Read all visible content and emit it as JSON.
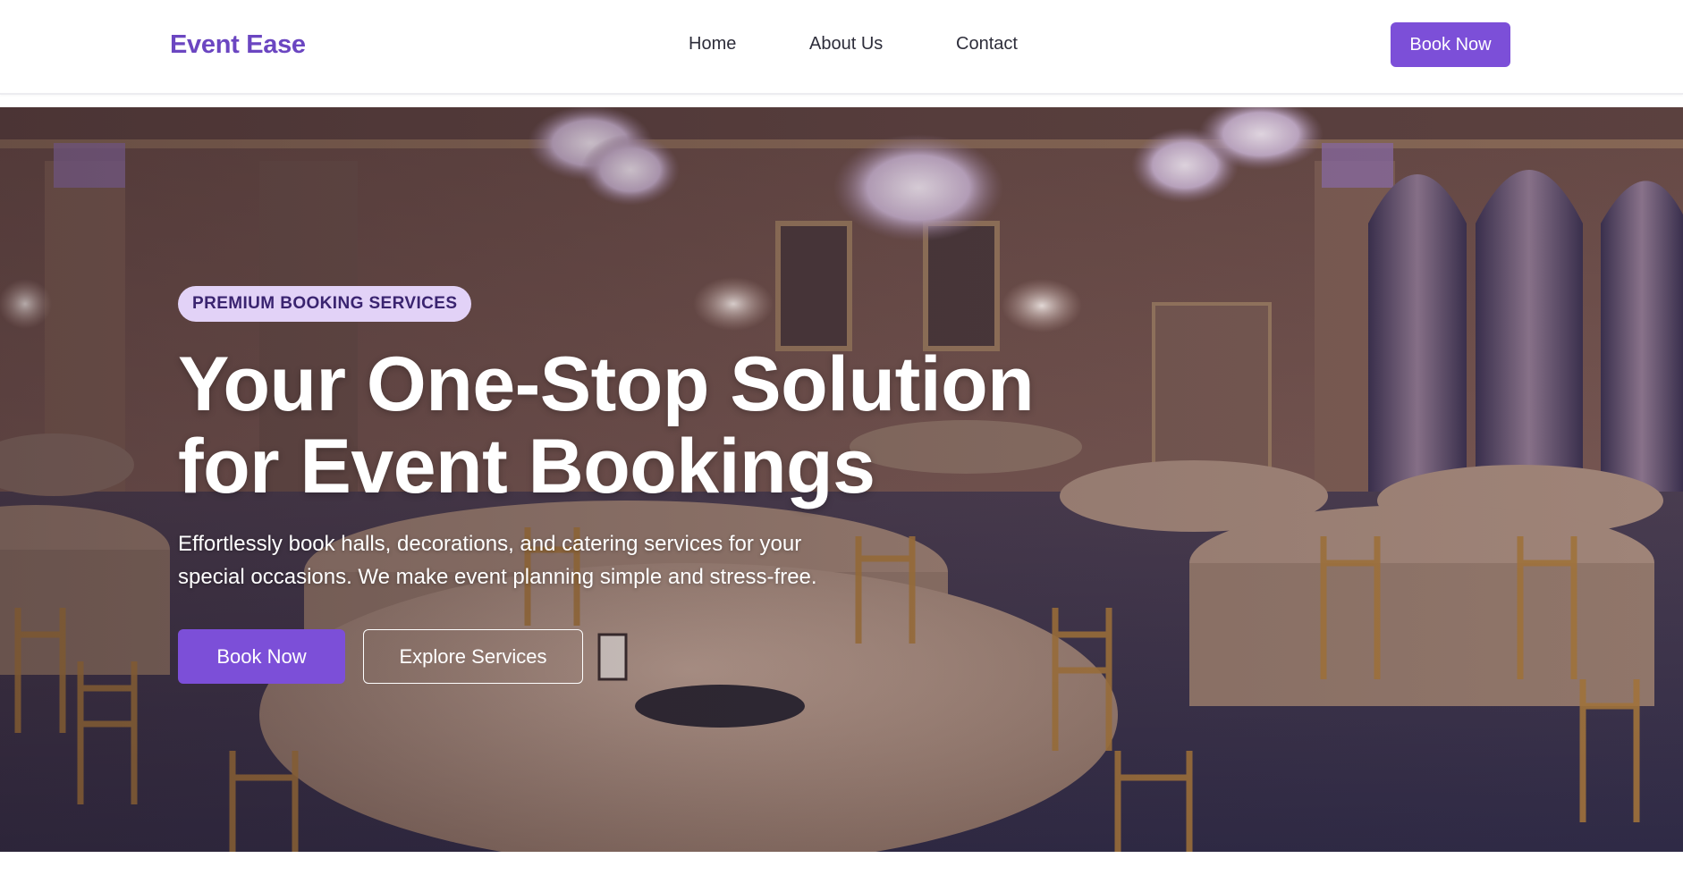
{
  "nav": {
    "brand": "Event Ease",
    "links": [
      "Home",
      "About Us",
      "Contact"
    ],
    "cta": "Book Now"
  },
  "hero": {
    "badge": "PREMIUM BOOKING SERVICES",
    "title_lines": [
      "Your One-Stop Solution",
      "for Event Bookings"
    ],
    "subtitle_lines": [
      "Effortlessly book halls, decorations, and catering services for your",
      "special occasions. We make event planning simple and stress-free."
    ],
    "primary_button": "Book Now",
    "secondary_button": "Explore Services",
    "background_image": "banquet-hall-photo"
  },
  "colors": {
    "brand": "#6b46c1",
    "accent": "#7c4fd8",
    "badge_bg": "#e2d2f7",
    "badge_text": "#3a2470",
    "nav_text": "#2d2d3a"
  }
}
